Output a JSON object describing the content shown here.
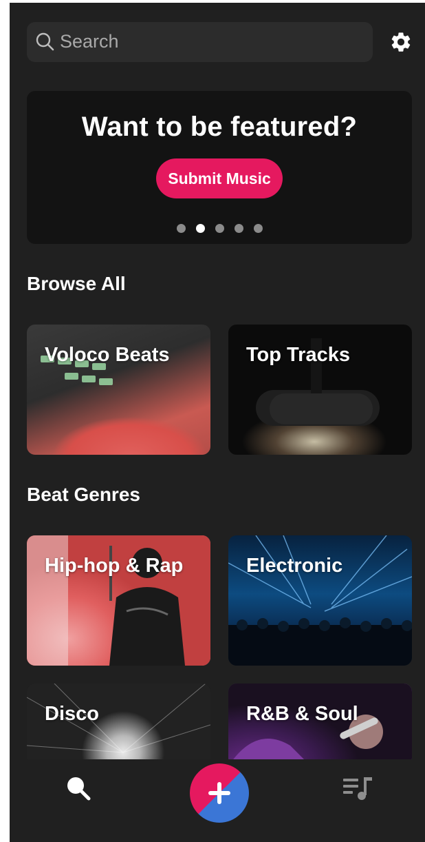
{
  "search": {
    "placeholder": "Search",
    "icon": "search-icon"
  },
  "settings": {
    "icon": "gear-icon"
  },
  "banner": {
    "title": "Want to be featured?",
    "button_label": "Submit Music",
    "dots": {
      "count": 5,
      "active_index": 1
    }
  },
  "browse": {
    "title": "Browse All",
    "cards": [
      {
        "label": "Voloco Beats"
      },
      {
        "label": "Top Tracks"
      }
    ]
  },
  "genres": {
    "title": "Beat Genres",
    "cards": [
      {
        "label": "Hip-hop & Rap"
      },
      {
        "label": "Electronic"
      },
      {
        "label": "Disco"
      },
      {
        "label": "R&B & Soul"
      }
    ]
  },
  "bottom_nav": {
    "items": [
      "search-icon",
      "plus-icon",
      "music-library-icon"
    ]
  },
  "colors": {
    "accent": "#e5195f",
    "fab_secondary": "#3b76d6",
    "background": "#202020",
    "banner": "#131313"
  }
}
